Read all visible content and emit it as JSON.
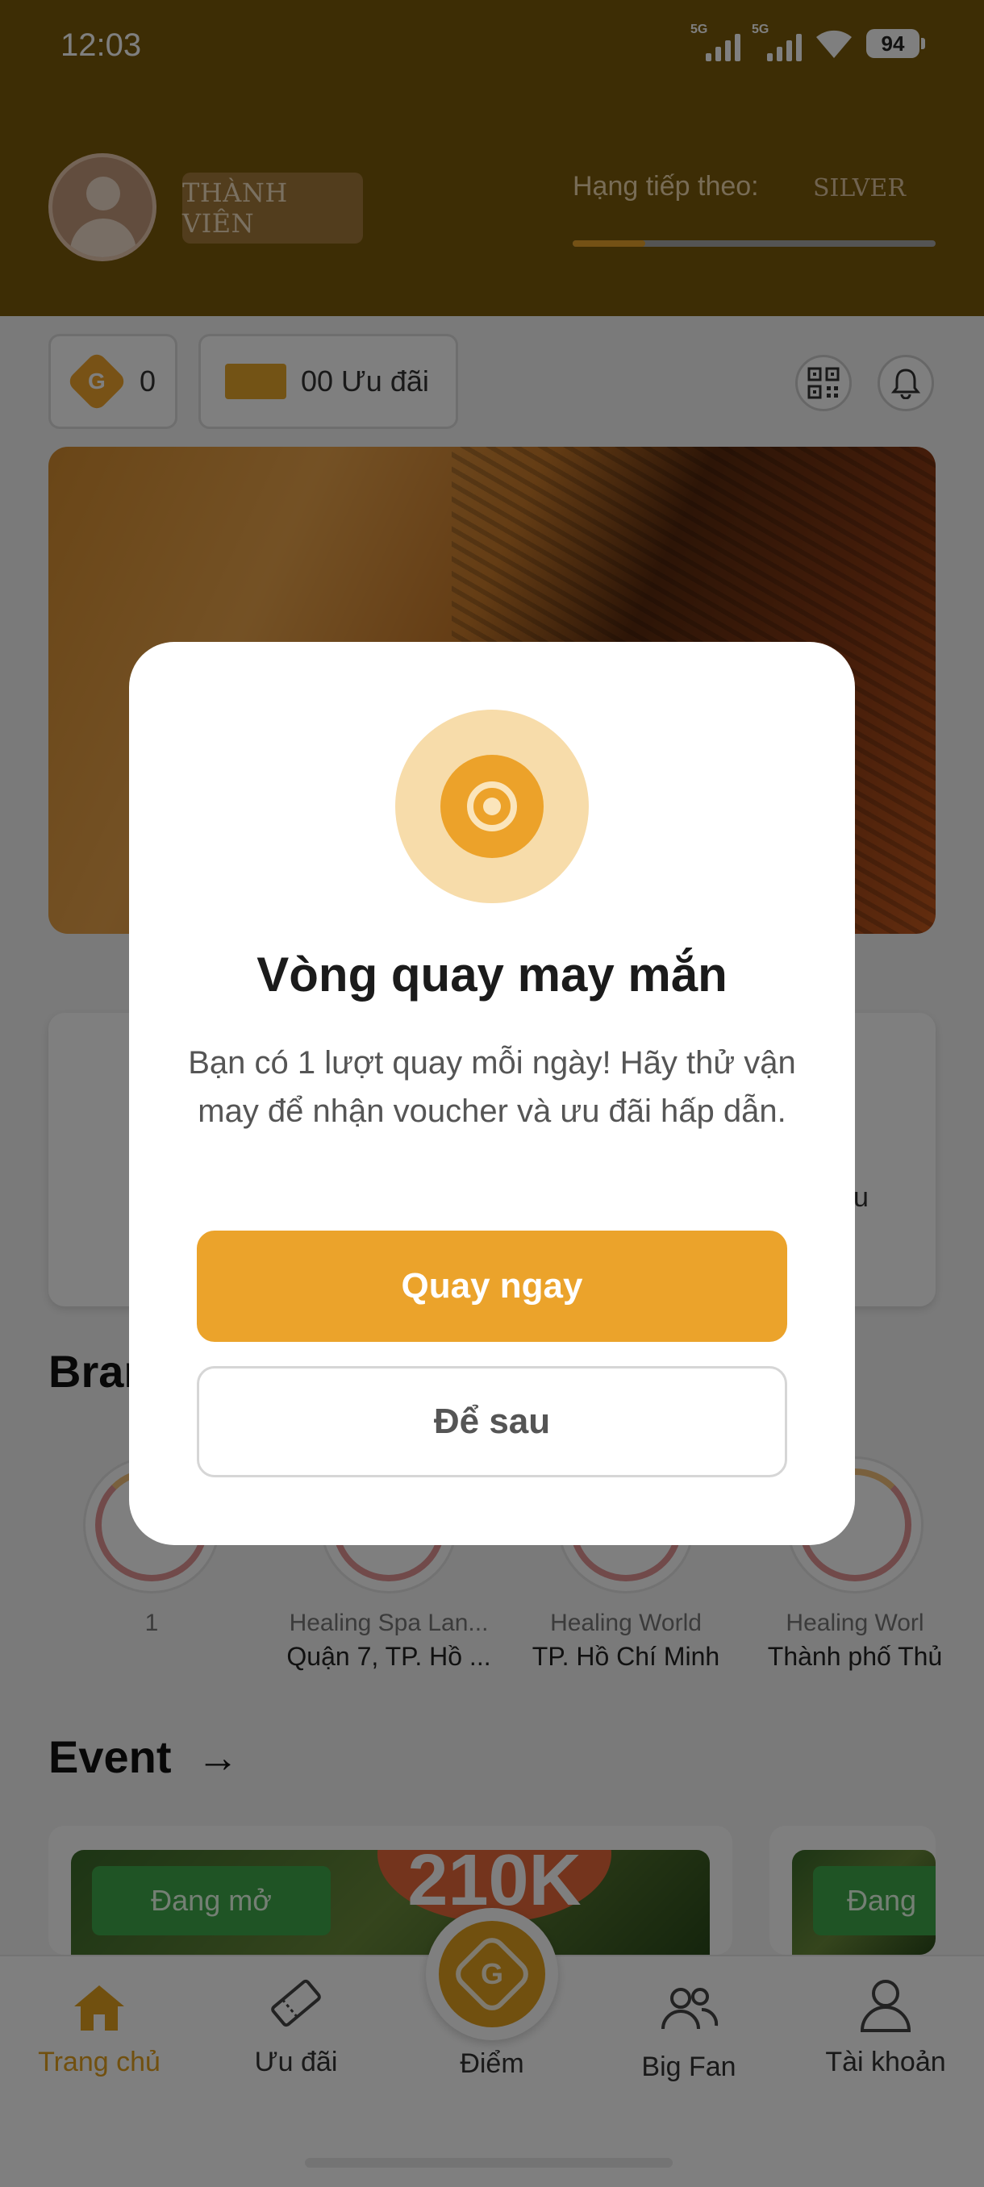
{
  "status_bar": {
    "time": "12:03",
    "sim1_tag": "5G",
    "sim2_tag": "5G",
    "battery": "94"
  },
  "header": {
    "member_badge": "THÀNH VIÊN",
    "next_tier_label": "Hạng tiếp theo:",
    "next_tier_value": "SILVER",
    "tier_progress": 0.2
  },
  "summary": {
    "points_value": "0",
    "points_icon_letter": "G",
    "voucher_label": "00 Ưu đãi"
  },
  "quick_card": {
    "tail_text": "u"
  },
  "brands": {
    "title": "Bran",
    "items": [
      {
        "name": "1",
        "location": ""
      },
      {
        "name": "Healing Spa Lan...",
        "location": "Quận 7, TP. Hồ ..."
      },
      {
        "name": "Healing World",
        "location": "TP. Hồ Chí Minh"
      },
      {
        "name": "Healing Worl",
        "location": "Thành phố Thủ"
      }
    ]
  },
  "events": {
    "title": "Event",
    "cards": [
      {
        "status": "Đang mở",
        "price": "210K"
      },
      {
        "status": "Đang"
      }
    ]
  },
  "bottom_nav": {
    "items": [
      {
        "label": "Trang chủ",
        "icon": "home-icon",
        "active": true
      },
      {
        "label": "Ưu đãi",
        "icon": "ticket-icon",
        "active": false
      },
      {
        "label": "Điểm",
        "icon": "points-icon",
        "active": false
      },
      {
        "label": "Big Fan",
        "icon": "group-icon",
        "active": false
      },
      {
        "label": "Tài khoản",
        "icon": "user-icon",
        "active": false
      }
    ],
    "center_letter": "G"
  },
  "modal": {
    "title": "Vòng quay may mắn",
    "description": "Bạn có 1 lượt quay mỗi ngày! Hãy thử vận may để nhận voucher và ưu đãi hấp dẫn.",
    "primary_label": "Quay ngay",
    "secondary_label": "Để sau"
  },
  "colors": {
    "header_bg": "#7a5a0a",
    "accent": "#eba32b",
    "active_nav": "#e3a01e",
    "badge_green": "#3ea84b"
  }
}
